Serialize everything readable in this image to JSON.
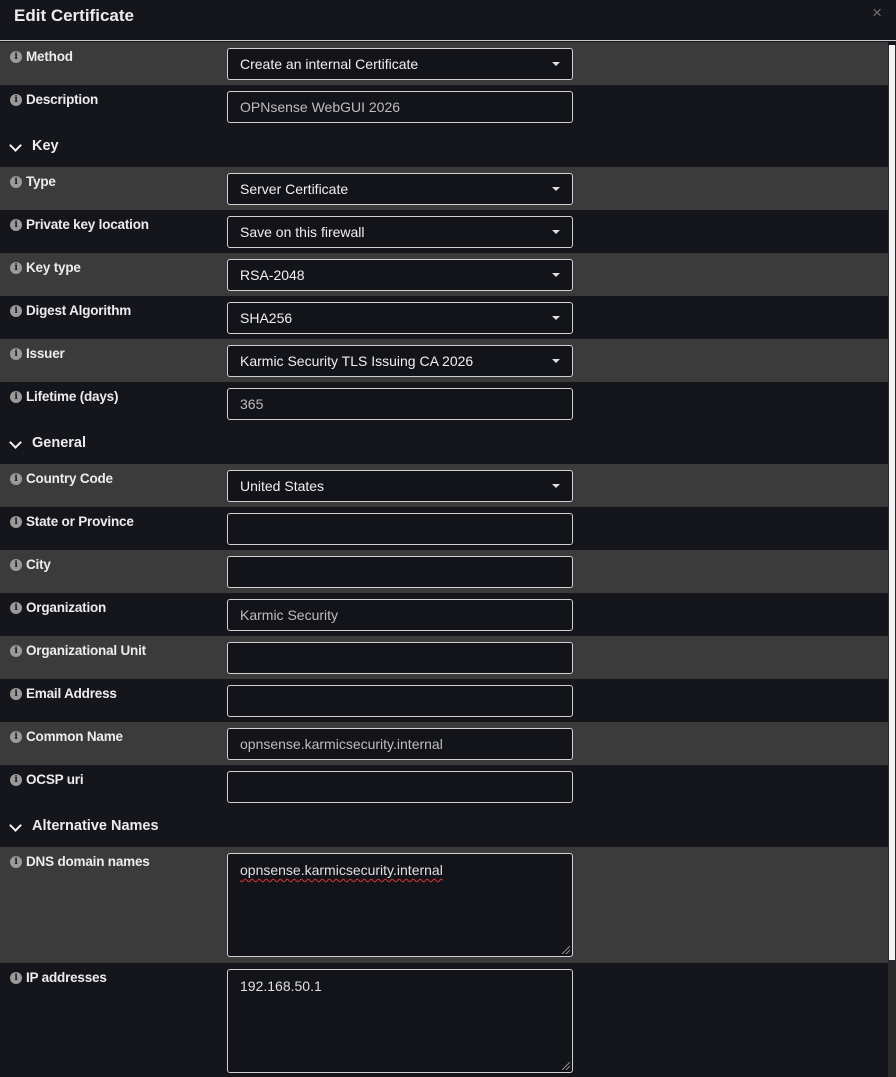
{
  "dialog": {
    "title": "Edit Certificate",
    "close_glyph": "×"
  },
  "fields": {
    "method": {
      "label": "Method",
      "value": "Create an internal Certificate"
    },
    "description": {
      "label": "Description",
      "value": "OPNsense WebGUI 2026"
    },
    "type": {
      "label": "Type",
      "value": "Server Certificate"
    },
    "private_key_location": {
      "label": "Private key location",
      "value": "Save on this firewall"
    },
    "key_type": {
      "label": "Key type",
      "value": "RSA-2048"
    },
    "digest_algorithm": {
      "label": "Digest Algorithm",
      "value": "SHA256"
    },
    "issuer": {
      "label": "Issuer",
      "value": "Karmic Security TLS Issuing CA 2026"
    },
    "lifetime": {
      "label": "Lifetime (days)",
      "value": "365"
    },
    "country_code": {
      "label": "Country Code",
      "value": "United States"
    },
    "state": {
      "label": "State or Province",
      "value": ""
    },
    "city": {
      "label": "City",
      "value": ""
    },
    "organization": {
      "label": "Organization",
      "value": "Karmic Security"
    },
    "org_unit": {
      "label": "Organizational Unit",
      "value": ""
    },
    "email": {
      "label": "Email Address",
      "value": ""
    },
    "common_name": {
      "label": "Common Name",
      "value": "opnsense.karmicsecurity.internal"
    },
    "ocsp_uri": {
      "label": "OCSP uri",
      "value": ""
    },
    "dns_names": {
      "label": "DNS domain names",
      "value": "opnsense.karmicsecurity.internal"
    },
    "ip_addresses": {
      "label": "IP addresses",
      "value": "192.168.50.1"
    }
  },
  "sections": {
    "key": "Key",
    "general": "General",
    "alt_names": "Alternative Names"
  },
  "icons": {
    "info": "info-circle-icon",
    "caret": "caret-down-icon",
    "chevron": "chevron-down-icon",
    "close": "close-icon"
  },
  "colors": {
    "background": "#15161c",
    "row_alt": "#3b3b3b",
    "field_border": "#d0d0d0"
  }
}
